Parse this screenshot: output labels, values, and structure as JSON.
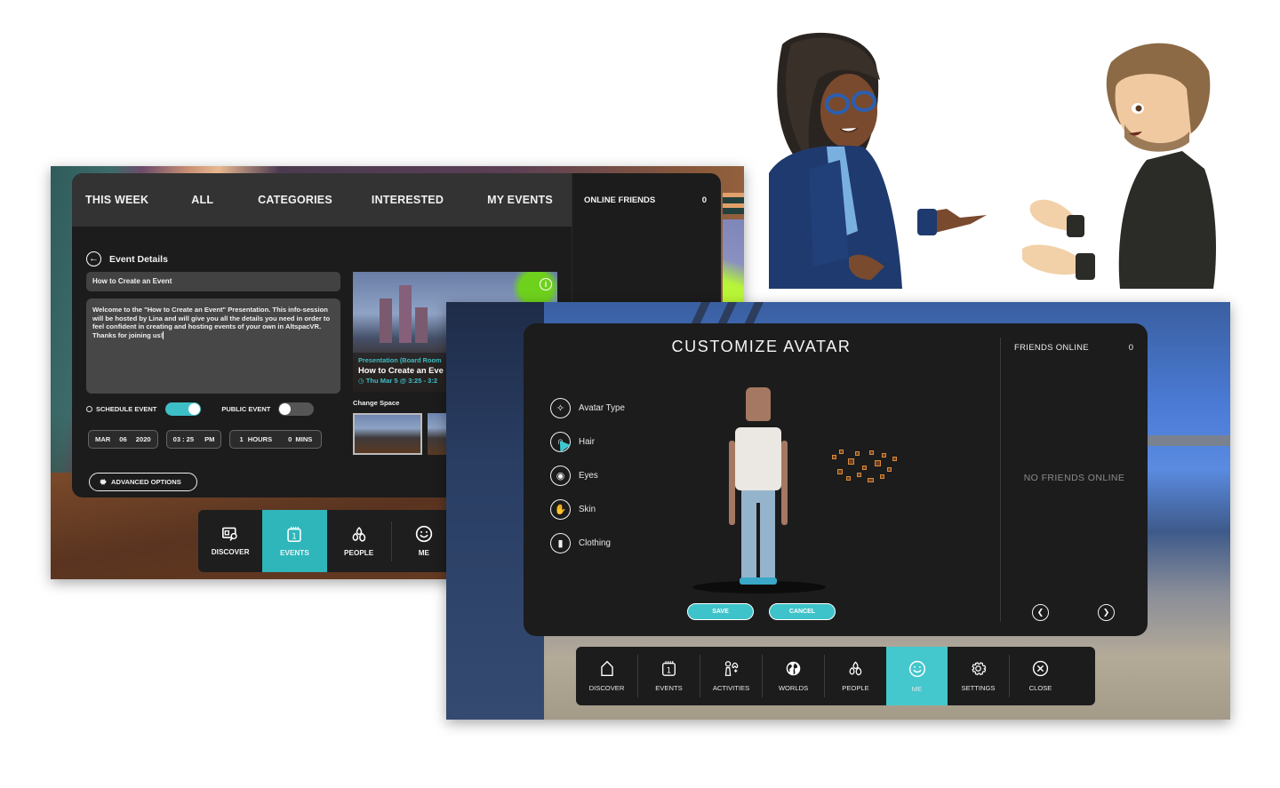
{
  "events_screen": {
    "tabs": [
      "THIS WEEK",
      "ALL",
      "CATEGORIES",
      "INTERESTED",
      "MY EVENTS"
    ],
    "header_title": "Event Details",
    "event_name": "How to Create an Event",
    "event_description": "Welcome to the \"How to Create an Event\" Presentation. This info-session will be hosted by Lina and will give you all the details you need in order to feel confident in creating and hosting events of your own in AltspacVR. Thanks for joining us!",
    "schedule_event_label": "SCHEDULE EVENT",
    "schedule_event_on": true,
    "public_event_label": "PUBLIC EVENT",
    "public_event_on": false,
    "date": {
      "month": "MAR",
      "day": "06",
      "year": "2020"
    },
    "time": {
      "hour": "03",
      "sep": ":",
      "minute": "25",
      "ampm": "PM"
    },
    "duration": {
      "hours": "1",
      "hours_label": "HOURS",
      "mins": "0",
      "mins_label": "MINS"
    },
    "advanced_options_label": "ADVANCED OPTIONS",
    "space_card": {
      "type": "Presentation (Board Room",
      "title": "How to Create an Eve",
      "time": "Thu Mar 5 @ 3:25 - 3:2"
    },
    "change_space_label": "Change Space",
    "online_friends_label": "ONLINE FRIENDS",
    "online_friends_count": "0",
    "nav": [
      {
        "label": "DISCOVER",
        "icon": "discover-icon",
        "active": false
      },
      {
        "label": "EVENTS",
        "icon": "events-calendar-icon",
        "active": true
      },
      {
        "label": "PEOPLE",
        "icon": "people-icon",
        "active": false
      },
      {
        "label": "ME",
        "icon": "smiley-icon",
        "active": false
      }
    ]
  },
  "avatar_screen": {
    "title": "CUSTOMIZE AVATAR",
    "menu": [
      {
        "label": "Avatar Type",
        "icon": "avatar-type-icon"
      },
      {
        "label": "Hair",
        "icon": "hair-icon"
      },
      {
        "label": "Eyes",
        "icon": "eye-icon"
      },
      {
        "label": "Skin",
        "icon": "hand-icon"
      },
      {
        "label": "Clothing",
        "icon": "clothing-icon"
      }
    ],
    "save_label": "SAVE",
    "cancel_label": "CANCEL",
    "friends_online_label": "FRIENDS ONLINE",
    "friends_online_count": "0",
    "no_friends_label": "NO FRIENDS ONLINE",
    "nav": [
      {
        "label": "DISCOVER",
        "icon": "home-icon",
        "active": false
      },
      {
        "label": "EVENTS",
        "icon": "events-calendar-icon",
        "active": false
      },
      {
        "label": "ACTIVITIES",
        "icon": "activities-icon",
        "active": false
      },
      {
        "label": "WORLDS",
        "icon": "globe-icon",
        "active": false
      },
      {
        "label": "PEOPLE",
        "icon": "people-icon",
        "active": false
      },
      {
        "label": "ME",
        "icon": "smiley-icon",
        "active": true
      },
      {
        "label": "SETTINGS",
        "icon": "gear-icon",
        "active": false
      },
      {
        "label": "CLOSE",
        "icon": "close-icon",
        "active": false
      }
    ]
  },
  "colors": {
    "accent_teal": "#2fb6bb",
    "accent_teal_light": "#44c7cd",
    "panel_bg": "#1c1c1c",
    "tab_bar_bg": "#333333"
  }
}
